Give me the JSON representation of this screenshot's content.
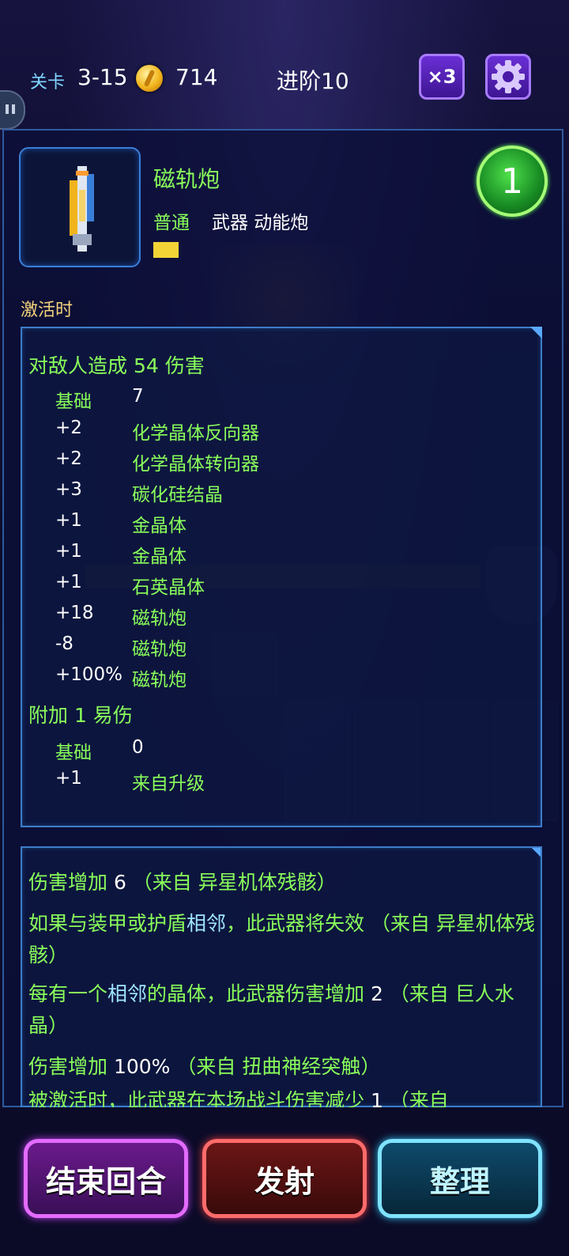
{
  "topbar": {
    "level_label": "关卡",
    "level_value": "3-15",
    "coins": "714",
    "stage": "进阶10",
    "speed_label": "×3"
  },
  "item": {
    "name": "磁轨炮",
    "rarity": "普通",
    "type": "武器 动能炮",
    "level_badge": "1",
    "activate_label": "激活时"
  },
  "damage": {
    "title": "对敌人造成 54 伤害",
    "rows": [
      {
        "value": "基础",
        "source": "7"
      },
      {
        "value": "+2",
        "source": "化学晶体反向器"
      },
      {
        "value": "+2",
        "source": "化学晶体转向器"
      },
      {
        "value": "+3",
        "source": "碳化硅结晶"
      },
      {
        "value": "+1",
        "source": "金晶体"
      },
      {
        "value": "+1",
        "source": "金晶体"
      },
      {
        "value": "+1",
        "source": "石英晶体"
      },
      {
        "value": "+18",
        "source": "磁轨炮"
      },
      {
        "value": "-8",
        "source": "磁轨炮"
      },
      {
        "value": "+100%",
        "source": "磁轨炮"
      }
    ]
  },
  "vuln": {
    "title": "附加 1 易伤",
    "rows": [
      {
        "value": "基础",
        "source": "0"
      },
      {
        "value": "+1",
        "source": "来自升级"
      }
    ]
  },
  "effects": {
    "e1": {
      "a": "伤害增加 ",
      "n": "6",
      "b": " （来自 异星机体残骸）"
    },
    "e2": {
      "a": "如果与装甲或护盾",
      "k": "相邻",
      "b": "，此武器将失效 （来自 异星机体残骸）"
    },
    "e3": {
      "a": "每有一个",
      "k": "相邻",
      "b": "的晶体，此武器伤害增加 ",
      "n": "2",
      "c": " （来自 巨人水晶）"
    },
    "e4": {
      "a": "伤害增加 ",
      "n": "100%",
      "b": " （来自 扭曲神经突触）"
    },
    "e5": {
      "a": "被激活时，此武器在本场战斗伤害减少 ",
      "n": "1",
      "b": " （来自"
    }
  },
  "buttons": {
    "end_turn": "结束回合",
    "fire": "发射",
    "sort": "整理"
  },
  "colors": {
    "green": "#8aff5a",
    "gold": "#f2d27b",
    "panel_border": "#3d7dc9"
  }
}
